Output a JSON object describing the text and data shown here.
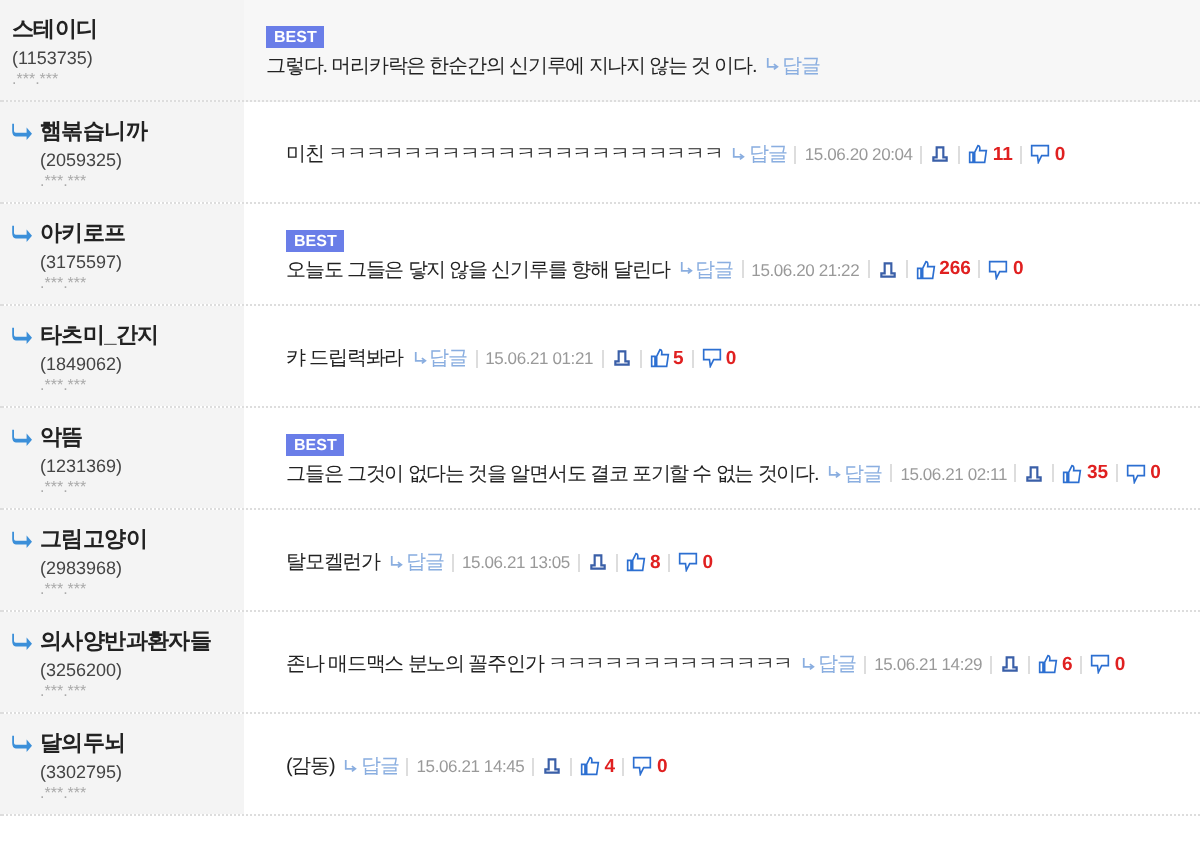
{
  "comments": [
    {
      "kind": "comment",
      "author": "스테이디",
      "user_id": "(1153735)",
      "ip": ".***.***",
      "best_badge": "BEST",
      "text": "그렇다. 머리카락은 한순간의 신기루에 지나지 않는 것 이다.",
      "reply_label": "답글"
    },
    {
      "kind": "reply",
      "author": "햄볶습니까",
      "user_id": "(2059325)",
      "ip": ".***.***",
      "text": "미친 ㅋㅋㅋㅋㅋㅋㅋㅋㅋㅋㅋㅋㅋㅋㅋㅋㅋㅋㅋㅋㅋ",
      "reply_label": "답글",
      "date": "15.06.20 20:04",
      "up": "11",
      "down": "0"
    },
    {
      "kind": "reply",
      "author": "아키로프",
      "user_id": "(3175597)",
      "ip": ".***.***",
      "best_badge": "BEST",
      "text": "오늘도 그들은 닿지 않을 신기루를 향해 달린다",
      "reply_label": "답글",
      "date": "15.06.20 21:22",
      "up": "266",
      "down": "0"
    },
    {
      "kind": "reply",
      "author": "타츠미_간지",
      "user_id": "(1849062)",
      "ip": ".***.***",
      "text": "캬 드립력봐라",
      "reply_label": "답글",
      "date": "15.06.21 01:21",
      "up": "5",
      "down": "0"
    },
    {
      "kind": "reply",
      "author": "악뜸",
      "user_id": "(1231369)",
      "ip": ".***.***",
      "best_badge": "BEST",
      "text": "그들은 그것이 없다는 것을 알면서도 결코 포기할 수 없는 것이다.",
      "reply_label": "답글",
      "date": "15.06.21 02:11",
      "up": "35",
      "down": "0"
    },
    {
      "kind": "reply",
      "author": "그림고양이",
      "user_id": "(2983968)",
      "ip": ".***.***",
      "text": "탈모켈런가",
      "reply_label": "답글",
      "date": "15.06.21 13:05",
      "up": "8",
      "down": "0"
    },
    {
      "kind": "reply",
      "author": "의사양반과환자들",
      "user_id": "(3256200)",
      "ip": ".***.***",
      "text": "존나 매드맥스 분노의 꼴주인가 ㅋㅋㅋㅋㅋㅋㅋㅋㅋㅋㅋㅋㅋ",
      "reply_label": "답글",
      "date": "15.06.21 14:29",
      "up": "6",
      "down": "0"
    },
    {
      "kind": "reply",
      "author": "달의두뇌",
      "user_id": "(3302795)",
      "ip": ".***.***",
      "text": "(감동)",
      "reply_label": "답글",
      "date": "15.06.21 14:45",
      "up": "4",
      "down": "0"
    }
  ]
}
